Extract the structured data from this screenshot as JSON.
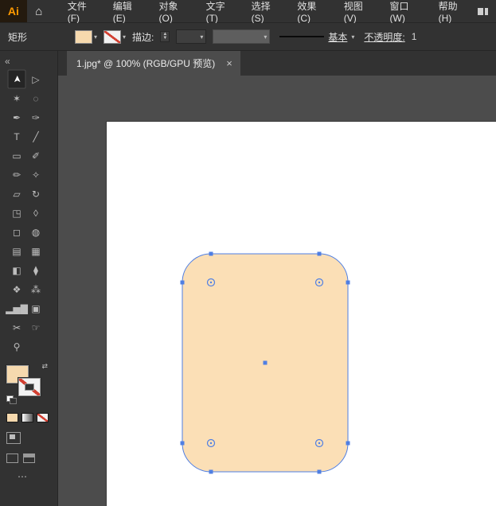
{
  "titlebar": {
    "logo": "Ai",
    "home_icon": "⌂",
    "menus": [
      "文件(F)",
      "编辑(E)",
      "对象(O)",
      "文字(T)",
      "选择(S)",
      "效果(C)",
      "视图(V)",
      "窗口(W)",
      "帮助(H)"
    ]
  },
  "controlbar": {
    "selection_label": "矩形",
    "stroke_label": "描边:",
    "stepper_up": "▲",
    "stepper_down": "▼",
    "caret": "▾",
    "brush_label": "基本",
    "opacity_label": "不透明度:",
    "opacity_value": "1"
  },
  "tabbar": {
    "collapse": "«",
    "tab_label": "1.jpg* @ 100% (RGB/GPU 预览)",
    "close": "×"
  },
  "toolbar": {
    "selected": "selection-tool",
    "tools": [
      {
        "name": "selection-tool",
        "glyph": "➤"
      },
      {
        "name": "direct-selection-tool",
        "glyph": "▷"
      },
      {
        "name": "magic-wand-tool",
        "glyph": "✶"
      },
      {
        "name": "lasso-tool",
        "glyph": "◌"
      },
      {
        "name": "pen-tool",
        "glyph": "✒"
      },
      {
        "name": "curvature-tool",
        "glyph": "✑"
      },
      {
        "name": "type-tool",
        "glyph": "T"
      },
      {
        "name": "line-segment-tool",
        "glyph": "╱"
      },
      {
        "name": "rectangle-tool",
        "glyph": "▭"
      },
      {
        "name": "paintbrush-tool",
        "glyph": "✐"
      },
      {
        "name": "pencil-tool",
        "glyph": "✏"
      },
      {
        "name": "shaper-tool",
        "glyph": "✧"
      },
      {
        "name": "eraser-tool",
        "glyph": "▱"
      },
      {
        "name": "rotate-tool",
        "glyph": "↻"
      },
      {
        "name": "scale-tool",
        "glyph": "◳"
      },
      {
        "name": "width-tool",
        "glyph": "◊"
      },
      {
        "name": "free-transform-tool",
        "glyph": "◻"
      },
      {
        "name": "shape-builder-tool",
        "glyph": "◍"
      },
      {
        "name": "perspective-grid-tool",
        "glyph": "▤"
      },
      {
        "name": "mesh-tool",
        "glyph": "▦"
      },
      {
        "name": "gradient-tool",
        "glyph": "◧"
      },
      {
        "name": "eyedropper-tool",
        "glyph": "⧫"
      },
      {
        "name": "blend-tool",
        "glyph": "❖"
      },
      {
        "name": "symbol-sprayer-tool",
        "glyph": "⁂"
      },
      {
        "name": "column-graph-tool",
        "glyph": "▂▅▇"
      },
      {
        "name": "artboard-tool",
        "glyph": "▣"
      },
      {
        "name": "slice-tool",
        "glyph": "✂"
      },
      {
        "name": "hand-tool",
        "glyph": "☞"
      },
      {
        "name": "zoom-tool",
        "glyph": "⚲"
      }
    ],
    "swap_icon": "⇄",
    "ellipsis": "⋯"
  },
  "colors": {
    "bar": "#323232",
    "canvas": "#4c4c4c",
    "tab_bg": "#4c4c4c",
    "artboard": "#ffffff",
    "shape_fill": "#fbdfb6",
    "selection_blue": "#4f7fe3",
    "swatch_peach": "#f6d9ae",
    "none_red": "#d23f31",
    "logo_orange": "#ff9a00",
    "disabled_gray": "#5e5e5e"
  }
}
